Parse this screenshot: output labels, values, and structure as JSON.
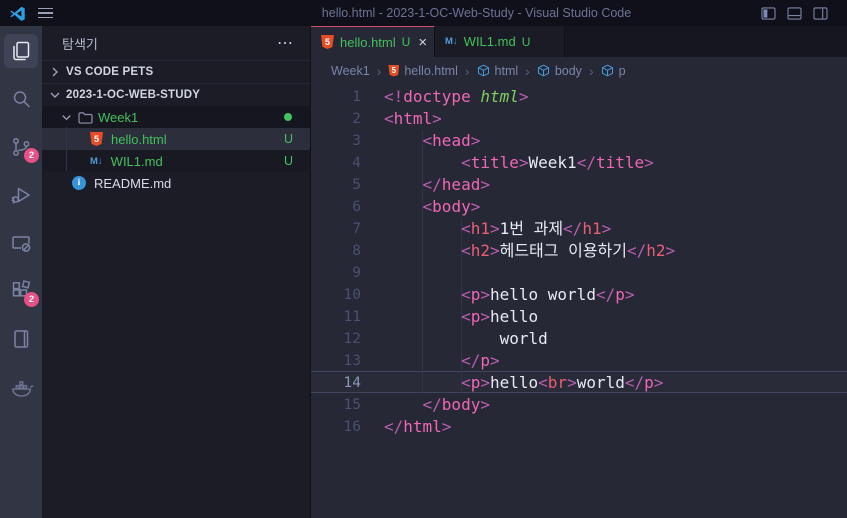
{
  "window": {
    "title": "hello.html - 2023-1-OC-Web-Study - Visual Studio Code"
  },
  "icons": {
    "more_actions": "⋯",
    "close": "×",
    "breadcrumb_separator": "›",
    "chevron_right": "›",
    "chevron_down": "⌄",
    "markdown_glyph": "M↓",
    "html_glyph": "5",
    "info_glyph": "i"
  },
  "activity_bar": {
    "items": [
      {
        "name": "explorer",
        "active": true,
        "badge": ""
      },
      {
        "name": "search",
        "badge": ""
      },
      {
        "name": "source-control",
        "badge": "2"
      },
      {
        "name": "run-and-debug",
        "badge": ""
      },
      {
        "name": "remote-window",
        "badge": ""
      },
      {
        "name": "extensions",
        "badge": "2"
      },
      {
        "name": "notebook",
        "badge": ""
      },
      {
        "name": "docker",
        "badge": ""
      }
    ]
  },
  "sidebar": {
    "title": "탐색기",
    "sections": [
      {
        "label": "VS CODE PETS",
        "collapsed": true
      },
      {
        "label": "2023-1-OC-WEB-STUDY",
        "collapsed": false
      }
    ],
    "tree": [
      {
        "label": "Week1",
        "type": "folder",
        "expanded": true,
        "modified_dot": true
      },
      {
        "label": "hello.html",
        "type": "html",
        "git_status": "U",
        "selected": true
      },
      {
        "label": "WIL1.md",
        "type": "markdown",
        "git_status": "U",
        "selected": false
      },
      {
        "label": "README.md",
        "type": "readme",
        "git_status": "",
        "selected": false
      }
    ]
  },
  "editor_group": {
    "tabs": [
      {
        "label": "hello.html",
        "git_status": "U",
        "active": true,
        "type": "html"
      },
      {
        "label": "WIL1.md",
        "git_status": "U",
        "active": false,
        "type": "markdown"
      }
    ],
    "breadcrumb": [
      {
        "label": "Week1",
        "icon": ""
      },
      {
        "label": "hello.html",
        "icon": "html"
      },
      {
        "label": "html",
        "icon": "symbol"
      },
      {
        "label": "body",
        "icon": "symbol"
      },
      {
        "label": "p",
        "icon": "symbol"
      }
    ]
  },
  "editor": {
    "active_line": 14,
    "language": "html",
    "lines": [
      {
        "n": 1,
        "tokens": [
          [
            "br",
            "<!"
          ],
          [
            "pk",
            "doctype"
          ],
          [
            "tx",
            " "
          ],
          [
            "gr",
            "html"
          ],
          [
            "br",
            ">"
          ]
        ]
      },
      {
        "n": 2,
        "tokens": [
          [
            "br",
            "<"
          ],
          [
            "pk",
            "html"
          ],
          [
            "br",
            ">"
          ]
        ]
      },
      {
        "n": 3,
        "tokens": [
          [
            "tx",
            "    "
          ],
          [
            "br",
            "<"
          ],
          [
            "pk",
            "head"
          ],
          [
            "br",
            ">"
          ]
        ]
      },
      {
        "n": 4,
        "tokens": [
          [
            "tx",
            "        "
          ],
          [
            "br",
            "<"
          ],
          [
            "pk",
            "title"
          ],
          [
            "br",
            ">"
          ],
          [
            "tx",
            "Week1"
          ],
          [
            "br",
            "</"
          ],
          [
            "pk",
            "title"
          ],
          [
            "br",
            ">"
          ]
        ]
      },
      {
        "n": 5,
        "tokens": [
          [
            "tx",
            "    "
          ],
          [
            "br",
            "</"
          ],
          [
            "pk",
            "head"
          ],
          [
            "br",
            ">"
          ]
        ]
      },
      {
        "n": 6,
        "tokens": [
          [
            "tx",
            "    "
          ],
          [
            "br",
            "<"
          ],
          [
            "pk",
            "body"
          ],
          [
            "br",
            ">"
          ]
        ]
      },
      {
        "n": 7,
        "tokens": [
          [
            "tx",
            "        "
          ],
          [
            "br",
            "<"
          ],
          [
            "rd",
            "h1"
          ],
          [
            "br",
            ">"
          ],
          [
            "tx",
            "1번 과제"
          ],
          [
            "br",
            "</"
          ],
          [
            "rd",
            "h1"
          ],
          [
            "br",
            ">"
          ]
        ]
      },
      {
        "n": 8,
        "tokens": [
          [
            "tx",
            "        "
          ],
          [
            "br",
            "<"
          ],
          [
            "rd",
            "h2"
          ],
          [
            "br",
            ">"
          ],
          [
            "tx",
            "헤드태그 이용하기"
          ],
          [
            "br",
            "</"
          ],
          [
            "rd",
            "h2"
          ],
          [
            "br",
            ">"
          ]
        ]
      },
      {
        "n": 9,
        "tokens": []
      },
      {
        "n": 10,
        "tokens": [
          [
            "tx",
            "        "
          ],
          [
            "br",
            "<"
          ],
          [
            "pk",
            "p"
          ],
          [
            "br",
            ">"
          ],
          [
            "tx",
            "hello world"
          ],
          [
            "br",
            "</"
          ],
          [
            "pk",
            "p"
          ],
          [
            "br",
            ">"
          ]
        ]
      },
      {
        "n": 11,
        "tokens": [
          [
            "tx",
            "        "
          ],
          [
            "br",
            "<"
          ],
          [
            "pk",
            "p"
          ],
          [
            "br",
            ">"
          ],
          [
            "tx",
            "hello"
          ]
        ]
      },
      {
        "n": 12,
        "tokens": [
          [
            "tx",
            "            world"
          ]
        ]
      },
      {
        "n": 13,
        "tokens": [
          [
            "tx",
            "        "
          ],
          [
            "br",
            "</"
          ],
          [
            "pk",
            "p"
          ],
          [
            "br",
            ">"
          ]
        ]
      },
      {
        "n": 14,
        "tokens": [
          [
            "tx",
            "        "
          ],
          [
            "br",
            "<"
          ],
          [
            "pk",
            "p"
          ],
          [
            "br",
            ">"
          ],
          [
            "tx",
            "hello"
          ],
          [
            "br",
            "<"
          ],
          [
            "rd",
            "br"
          ],
          [
            "br",
            ">"
          ],
          [
            "tx",
            "world"
          ],
          [
            "br",
            "</"
          ],
          [
            "pk",
            "p"
          ],
          [
            "br",
            ">"
          ]
        ]
      },
      {
        "n": 15,
        "tokens": [
          [
            "tx",
            "    "
          ],
          [
            "br",
            "</"
          ],
          [
            "pk",
            "body"
          ],
          [
            "br",
            ">"
          ]
        ]
      },
      {
        "n": 16,
        "tokens": [
          [
            "br",
            "</"
          ],
          [
            "pk",
            "html"
          ],
          [
            "br",
            ">"
          ]
        ]
      }
    ]
  },
  "colors": {
    "git_untracked_green": "#42c15c",
    "badge_pink": "#e85186",
    "html_icon_orange": "#e44d26",
    "markdown_icon_blue": "#4f9cd8",
    "info_icon_blue": "#3794d6",
    "active_tab_accent": "#d04f6f",
    "tag_pink": "#f067b4",
    "tag_red": "#eb5e73",
    "attr_green": "#7fcf5f",
    "bracket_purple": "#bb5eb0",
    "editor_bg": "#262836",
    "sidebar_bg": "#1b1c26",
    "activitybar_bg": "#313544",
    "titlebar_bg": "#0f1019",
    "breadcrumb_symbol_blue": "#4596d8",
    "vscode_logo_blue": "#2c9fe5"
  }
}
